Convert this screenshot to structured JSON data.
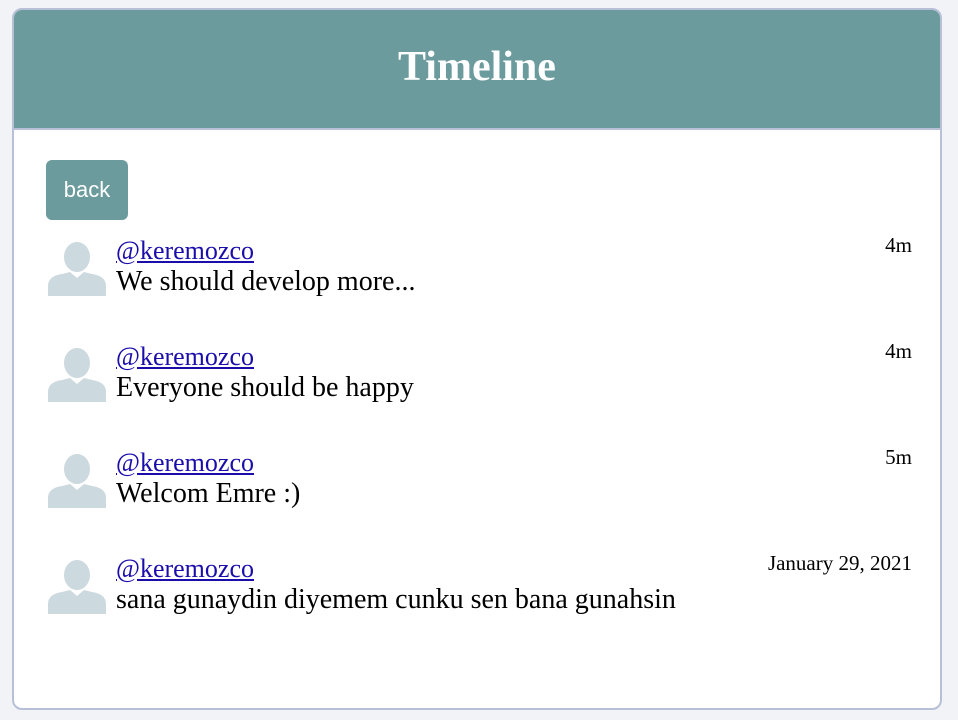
{
  "header": {
    "title": "Timeline"
  },
  "actions": {
    "back_label": "back"
  },
  "posts": [
    {
      "handle": "@keremozco",
      "text": "We should develop more...",
      "time": "4m"
    },
    {
      "handle": "@keremozco",
      "text": "Everyone should be happy",
      "time": "4m"
    },
    {
      "handle": "@keremozco",
      "text": "Welcom Emre :)",
      "time": "5m"
    },
    {
      "handle": "@keremozco",
      "text": "sana gunaydin diyemem cunku sen bana gunahsin",
      "time": "January 29, 2021"
    }
  ],
  "icons": {
    "avatar": "default-user-avatar-icon"
  },
  "colors": {
    "header_bg": "#6b9b9d",
    "link": "#1a0dab",
    "avatar": "#ccd9de"
  }
}
